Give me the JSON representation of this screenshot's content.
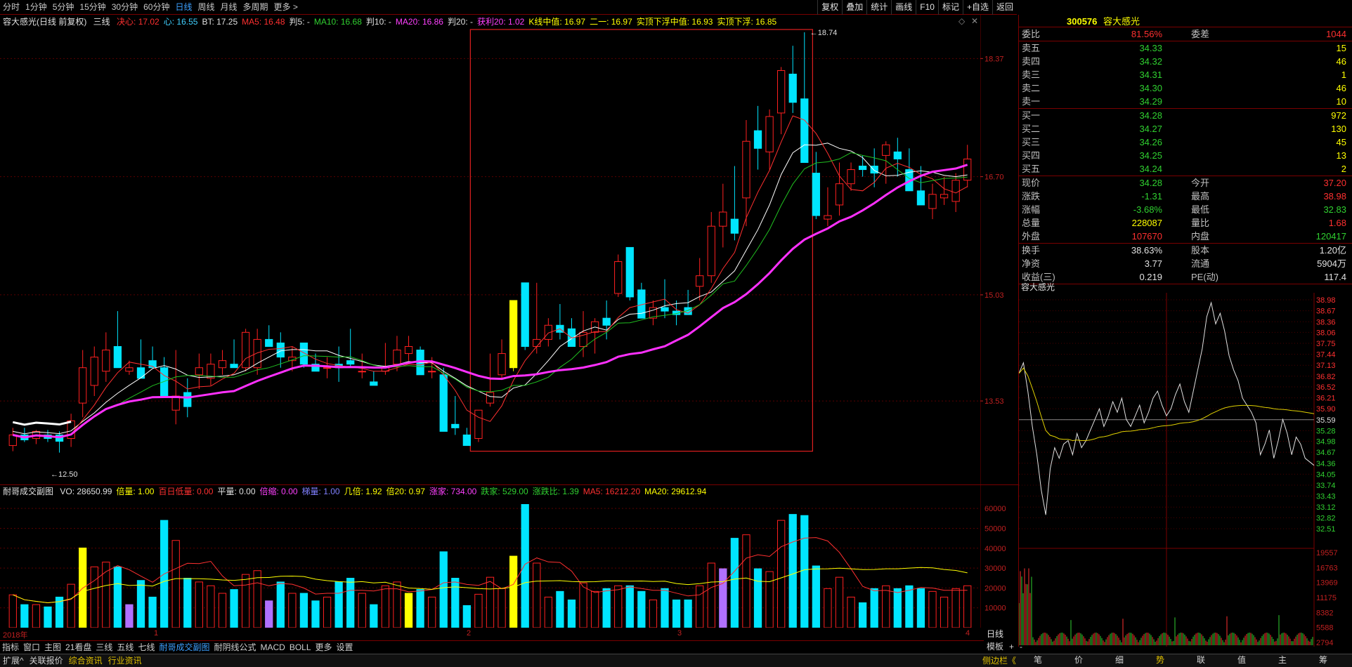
{
  "toolbar": {
    "periods": [
      "分时",
      "1分钟",
      "5分钟",
      "15分钟",
      "30分钟",
      "60分钟",
      "日线",
      "周线",
      "月线",
      "多周期",
      "更多 >"
    ],
    "active": "日线",
    "right_buttons": [
      "复权",
      "叠加",
      "统计",
      "画线",
      "F10",
      "标记",
      "+自选",
      "返回"
    ]
  },
  "stock": {
    "code": "300576",
    "name": "容大感光"
  },
  "info1": {
    "title": "容大感光(日线 前复权)",
    "lines_label": "三线",
    "items": [
      {
        "t": "决心: 17.02",
        "c": "#ff3030"
      },
      {
        "t": "心: 16.55",
        "c": "#40d0ff"
      },
      {
        "t": "BT: 17.25",
        "c": "#e0e0e0"
      },
      {
        "t": "MA5: 16.48",
        "c": "#ff3030"
      },
      {
        "t": "判5: -",
        "c": "#e0e0e0"
      },
      {
        "t": "MA10: 16.68",
        "c": "#30d030"
      },
      {
        "t": "判10: -",
        "c": "#e0e0e0"
      },
      {
        "t": "MA20: 16.86",
        "c": "#ff40ff"
      },
      {
        "t": "判20: -",
        "c": "#e0e0e0"
      },
      {
        "t": "获利20: 1.02",
        "c": "#ff40ff"
      },
      {
        "t": "K线中值: 16.97",
        "c": "#ffff00"
      },
      {
        "t": "二一: 16.97",
        "c": "#ffff00"
      },
      {
        "t": "实顶下浮中值: 16.93",
        "c": "#ffff00"
      },
      {
        "t": "实顶下浮: 16.85",
        "c": "#ffff00"
      }
    ]
  },
  "info2": {
    "title": "耐哥成交副图",
    "items": [
      {
        "t": "VO: 28650.99",
        "c": "#e0e0e0"
      },
      {
        "t": "倍量: 1.00",
        "c": "#ffff00"
      },
      {
        "t": "百日低量: 0.00",
        "c": "#ff3030"
      },
      {
        "t": "平量: 0.00",
        "c": "#e0e0e0"
      },
      {
        "t": "倍缩: 0.00",
        "c": "#ff40ff"
      },
      {
        "t": "梯量: 1.00",
        "c": "#8080ff"
      },
      {
        "t": "几倍: 1.92",
        "c": "#ffff00"
      },
      {
        "t": "倍20: 0.97",
        "c": "#ffff00"
      },
      {
        "t": "涨家: 734.00",
        "c": "#ff40ff"
      },
      {
        "t": "跌家: 529.00",
        "c": "#30d030"
      },
      {
        "t": "涨跌比: 1.39",
        "c": "#30d030"
      },
      {
        "t": "MA5: 16212.20",
        "c": "#ff3030"
      },
      {
        "t": "MA20: 29612.94",
        "c": "#ffff00"
      }
    ]
  },
  "chart_data": [
    {
      "type": "candlestick",
      "title": "容大感光(日线 前复权)",
      "y_ticks": [
        13.53,
        15.03,
        16.7,
        18.37
      ],
      "annotations": [
        "18.74",
        "12.50"
      ],
      "x_labels": [
        "2018年",
        "1",
        "2",
        "3",
        "4"
      ],
      "series": [
        {
          "name": "K线",
          "ohlc": [
            [
              12.9,
              13.15,
              12.82,
              13.05
            ],
            [
              13.05,
              13.15,
              12.95,
              12.98
            ],
            [
              13.0,
              13.12,
              12.92,
              13.1
            ],
            [
              13.05,
              13.12,
              12.95,
              13.0
            ],
            [
              13.05,
              13.1,
              12.8,
              12.96
            ],
            [
              13.0,
              13.35,
              12.88,
              13.25
            ],
            [
              13.5,
              14.25,
              13.3,
              14.0
            ],
            [
              13.75,
              14.3,
              13.6,
              14.15
            ],
            [
              13.95,
              14.5,
              13.8,
              14.25
            ],
            [
              14.3,
              14.8,
              14.1,
              14.0
            ],
            [
              13.95,
              14.1,
              13.9,
              14.0
            ],
            [
              14.0,
              14.4,
              13.88,
              13.85
            ],
            [
              14.1,
              14.3,
              14.0,
              14.0
            ],
            [
              14.0,
              14.15,
              13.6,
              13.6
            ],
            [
              13.4,
              14.25,
              13.2,
              13.6
            ],
            [
              13.65,
              13.85,
              13.3,
              13.45
            ],
            [
              13.9,
              14.2,
              13.7,
              14.0
            ],
            [
              13.85,
              14.2,
              13.75,
              14.05
            ],
            [
              14.0,
              14.25,
              13.9,
              14.1
            ],
            [
              14.05,
              14.4,
              14.0,
              14.0
            ],
            [
              14.0,
              14.55,
              13.95,
              14.5
            ],
            [
              14.0,
              14.55,
              13.9,
              14.4
            ],
            [
              14.4,
              14.6,
              14.35,
              14.3
            ],
            [
              14.35,
              14.5,
              14.0,
              14.15
            ],
            [
              14.1,
              14.3,
              13.95,
              14.15
            ],
            [
              14.35,
              14.35,
              14.0,
              14.05
            ],
            [
              14.05,
              14.2,
              13.95,
              13.95
            ],
            [
              14.0,
              14.15,
              13.85,
              14.0
            ],
            [
              14.05,
              14.3,
              13.8,
              14.0
            ],
            [
              14.1,
              14.55,
              14.0,
              14.05
            ],
            [
              13.95,
              14.2,
              13.85,
              13.95
            ],
            [
              13.8,
              13.95,
              13.75,
              13.75
            ],
            [
              13.95,
              14.35,
              13.9,
              14.0
            ],
            [
              14.05,
              14.45,
              13.95,
              14.25
            ],
            [
              14.2,
              14.45,
              14.1,
              14.3
            ],
            [
              14.25,
              14.3,
              13.9,
              13.9
            ],
            [
              13.95,
              14.15,
              13.85,
              13.95
            ],
            [
              13.9,
              14.0,
              13.1,
              13.1
            ],
            [
              13.2,
              13.6,
              13.05,
              13.15
            ],
            [
              13.05,
              13.15,
              12.9,
              12.9
            ],
            [
              13.0,
              13.4,
              12.95,
              13.4
            ],
            [
              13.5,
              14.2,
              13.45,
              13.65
            ],
            [
              13.9,
              14.4,
              13.85,
              14.2
            ],
            [
              14.0,
              14.2,
              13.95,
              14.95
            ],
            [
              15.2,
              15.2,
              14.25,
              14.3
            ],
            [
              14.3,
              15.2,
              14.2,
              14.4
            ],
            [
              14.4,
              14.7,
              14.3,
              14.6
            ],
            [
              14.6,
              14.9,
              14.4,
              14.5
            ],
            [
              14.55,
              14.7,
              14.35,
              14.3
            ],
            [
              14.3,
              14.8,
              14.15,
              14.5
            ],
            [
              14.5,
              14.7,
              14.2,
              14.65
            ],
            [
              14.7,
              14.95,
              14.4,
              14.6
            ],
            [
              15.05,
              15.6,
              15.0,
              15.5
            ],
            [
              15.7,
              15.55,
              14.95,
              15.0
            ],
            [
              15.1,
              15.2,
              14.7,
              14.7
            ],
            [
              14.7,
              14.95,
              14.6,
              14.85
            ],
            [
              14.85,
              15.25,
              14.7,
              14.8
            ],
            [
              14.8,
              14.95,
              14.6,
              14.75
            ],
            [
              14.85,
              15.1,
              14.75,
              14.75
            ],
            [
              15.15,
              15.55,
              14.95,
              15.3
            ],
            [
              15.3,
              16.2,
              15.2,
              16.0
            ],
            [
              16.0,
              16.6,
              15.7,
              16.2
            ],
            [
              16.1,
              16.85,
              15.8,
              15.9
            ],
            [
              16.4,
              17.5,
              16.0,
              17.2
            ],
            [
              17.35,
              17.7,
              16.8,
              17.1
            ],
            [
              17.05,
              17.65,
              16.8,
              17.55
            ],
            [
              17.6,
              18.25,
              17.3,
              18.2
            ],
            [
              18.15,
              18.55,
              17.6,
              17.75
            ],
            [
              17.8,
              18.74,
              16.9,
              16.9
            ],
            [
              16.75,
              17.05,
              16.1,
              16.15
            ],
            [
              16.1,
              16.55,
              16.0,
              16.15
            ],
            [
              16.3,
              16.9,
              16.15,
              16.6
            ],
            [
              16.6,
              16.9,
              16.5,
              16.8
            ],
            [
              16.85,
              17.0,
              16.7,
              16.8
            ],
            [
              16.85,
              17.1,
              16.55,
              16.75
            ],
            [
              17.0,
              17.2,
              16.6,
              17.15
            ],
            [
              17.05,
              17.25,
              16.7,
              16.95
            ],
            [
              16.8,
              17.1,
              16.5,
              16.5
            ],
            [
              16.5,
              16.85,
              16.3,
              16.3
            ],
            [
              16.25,
              16.6,
              16.1,
              16.45
            ],
            [
              16.4,
              16.7,
              16.3,
              16.45
            ],
            [
              16.35,
              16.75,
              16.2,
              16.65
            ],
            [
              16.65,
              17.15,
              16.55,
              16.95
            ]
          ]
        },
        {
          "name": "MA20",
          "color": "#ff40ff"
        },
        {
          "name": "MA10",
          "color": "#30d030"
        },
        {
          "name": "MA5",
          "color": "#ff3030"
        },
        {
          "name": "BT",
          "color": "#ffffff"
        }
      ],
      "ylim": [
        12.35,
        18.8
      ]
    },
    {
      "type": "bar",
      "title": "耐哥成交副图",
      "y_ticks": [
        10000,
        20000,
        30000,
        40000,
        50000,
        60000
      ],
      "ylim": [
        0,
        65000
      ]
    },
    {
      "type": "line",
      "title": "容大感光",
      "y_ticks": [
        38.98,
        38.67,
        38.36,
        38.06,
        37.75,
        37.44,
        37.13,
        36.82,
        36.52,
        36.21,
        35.9,
        35.59,
        35.28,
        34.98,
        34.67,
        34.36,
        34.05,
        33.74,
        33.43,
        33.12,
        32.82,
        32.51
      ],
      "vol_ticks": [
        19557,
        16763,
        13969,
        11175,
        8382,
        5588,
        2794
      ],
      "ylim": [
        32.35,
        39.1
      ]
    }
  ],
  "quote": {
    "top": [
      {
        "l": "委比",
        "v": "81.56%",
        "c": "#ff3030",
        "l2": "委差",
        "v2": "1044",
        "c2": "#ff3030"
      }
    ],
    "sell": [
      {
        "l": "卖五",
        "v": "34.33",
        "c": "#30d030",
        "v2": "15"
      },
      {
        "l": "卖四",
        "v": "34.32",
        "c": "#30d030",
        "v2": "46"
      },
      {
        "l": "卖三",
        "v": "34.31",
        "c": "#30d030",
        "v2": "1"
      },
      {
        "l": "卖二",
        "v": "34.30",
        "c": "#30d030",
        "v2": "46"
      },
      {
        "l": "卖一",
        "v": "34.29",
        "c": "#30d030",
        "v2": "10"
      }
    ],
    "buy": [
      {
        "l": "买一",
        "v": "34.28",
        "c": "#30d030",
        "v2": "972"
      },
      {
        "l": "买二",
        "v": "34.27",
        "c": "#30d030",
        "v2": "130"
      },
      {
        "l": "买三",
        "v": "34.26",
        "c": "#30d030",
        "v2": "45"
      },
      {
        "l": "买四",
        "v": "34.25",
        "c": "#30d030",
        "v2": "13"
      },
      {
        "l": "买五",
        "v": "34.24",
        "c": "#30d030",
        "v2": "2"
      }
    ],
    "stats": [
      {
        "l": "现价",
        "v": "34.28",
        "c": "#30d030",
        "l2": "今开",
        "v2": "37.20",
        "c2": "#ff3030"
      },
      {
        "l": "涨跌",
        "v": "-1.31",
        "c": "#30d030",
        "l2": "最高",
        "v2": "38.98",
        "c2": "#ff3030"
      },
      {
        "l": "涨幅",
        "v": "-3.68%",
        "c": "#30d030",
        "l2": "最低",
        "v2": "32.83",
        "c2": "#30d030"
      },
      {
        "l": "总量",
        "v": "228087",
        "c": "#ffff00",
        "l2": "量比",
        "v2": "1.68",
        "c2": "#ff3030"
      },
      {
        "l": "外盘",
        "v": "107670",
        "c": "#ff3030",
        "l2": "内盘",
        "v2": "120417",
        "c2": "#30d030"
      }
    ],
    "misc": [
      {
        "l": "换手",
        "v": "38.63%",
        "c": "#e0e0e0",
        "l2": "股本",
        "v2": "1.20亿",
        "c2": "#e0e0e0"
      },
      {
        "l": "净资",
        "v": "3.77",
        "c": "#e0e0e0",
        "l2": "流通",
        "v2": "5904万",
        "c2": "#e0e0e0"
      },
      {
        "l": "收益(三)",
        "v": "0.219",
        "c": "#e0e0e0",
        "l2": "PE(动)",
        "v2": "117.4",
        "c2": "#e0e0e0"
      }
    ]
  },
  "mini_title": "容大感光",
  "tabs1": [
    "指标",
    "窗口",
    "主图",
    "21看盘",
    "三线",
    "五线",
    "七线",
    "耐哥成交副图",
    "耐阴线公式",
    "MACD",
    "BOLL",
    "更多",
    "设置"
  ],
  "tabs1_active": "耐哥成交副图",
  "tabs1_right": [
    "模板",
    "+",
    "-"
  ],
  "period_label": "日线",
  "tabs2": [
    "扩展^",
    "关联报价",
    "综合资讯",
    "行业资讯"
  ],
  "tabs2_right": "侧边栏《",
  "minitabs": [
    "笔",
    "价",
    "细",
    "势",
    "联",
    "值",
    "主",
    "筹"
  ],
  "minitabs_active": "势"
}
